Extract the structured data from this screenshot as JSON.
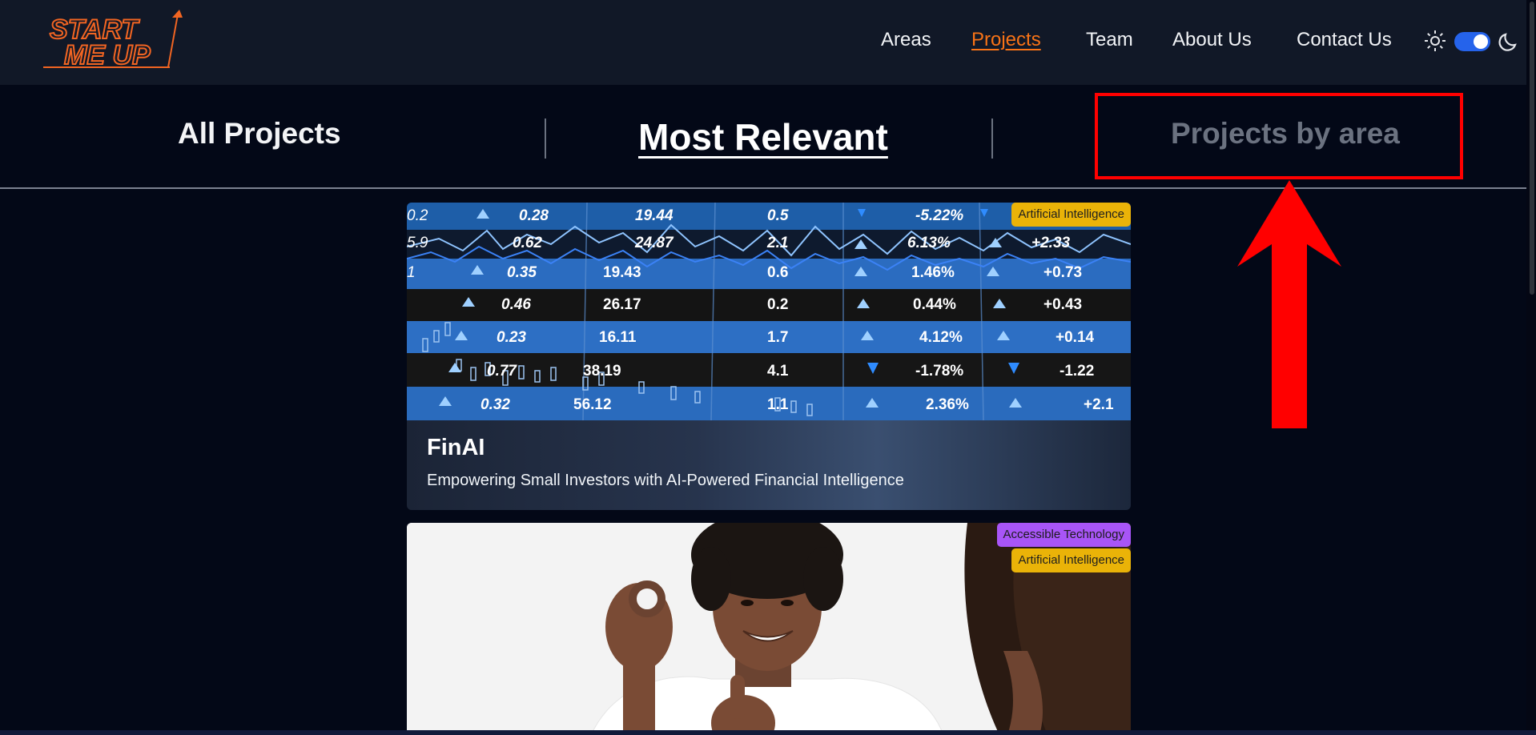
{
  "brand": {
    "logo_line1": "START",
    "logo_line2": "ME UP",
    "logo_color": "#f26522"
  },
  "nav": {
    "items": [
      {
        "label": "Areas",
        "active": false
      },
      {
        "label": "Projects",
        "active": true
      },
      {
        "label": "Team",
        "active": false
      },
      {
        "label": "About Us",
        "active": false
      },
      {
        "label": "Contact Us",
        "active": false
      }
    ],
    "theme_toggle": {
      "state": "dark",
      "accent": "#2563eb"
    }
  },
  "tabs": {
    "all": "All Projects",
    "relevant": "Most Relevant",
    "area": "Projects by area",
    "selected": "Most Relevant"
  },
  "annotation": {
    "highlight_color": "#ff0000"
  },
  "cards": [
    {
      "title": "FinAI",
      "description": "Empowering Small Investors with AI-Powered Financial Intelligence",
      "badges": [
        "Artificial Intelligence"
      ],
      "ticker_rows": [
        [
          "0.2",
          "0.28",
          "19.44",
          "0.5",
          "-5.22%",
          "+2.33"
        ],
        [
          "5.9",
          "0.62",
          "24.87",
          "2.1",
          "6.13%",
          ""
        ],
        [
          "1",
          "0.35",
          "19.43",
          "0.6",
          "1.46%",
          "+0.73"
        ],
        [
          "",
          "0.46",
          "26.17",
          "0.2",
          "0.44%",
          "+0.43"
        ],
        [
          "",
          "0.23",
          "16.11",
          "1.7",
          "4.12%",
          "+0.14"
        ],
        [
          "",
          "0.77",
          "38.19",
          "4.1",
          "-1.78%",
          "-1.22"
        ],
        [
          "",
          "0.32",
          "56.12",
          "1.1",
          "2.36%",
          "+2.1"
        ]
      ]
    },
    {
      "title": "",
      "description": "",
      "badges": [
        "Accessible Technology",
        "Artificial Intelligence"
      ]
    }
  ],
  "colors": {
    "ai_badge": "#eab308",
    "access_badge": "#a855f7",
    "active_nav": "#f97316"
  }
}
